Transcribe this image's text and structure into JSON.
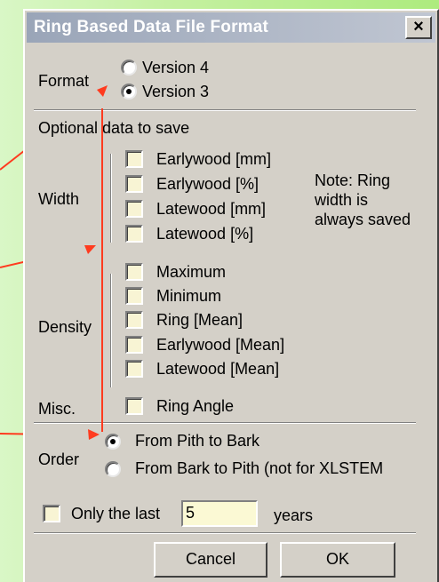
{
  "dialog": {
    "title": "Ring Based Data File Format",
    "close_glyph": "×",
    "format": {
      "label": "Format",
      "options": [
        {
          "label": "Version 4",
          "selected": false
        },
        {
          "label": "Version 3",
          "selected": true
        }
      ]
    },
    "optional": {
      "heading": "Optional data to save",
      "width": {
        "label": "Width",
        "items": [
          "Earlywood [mm]",
          "Earlywood [%]",
          "Latewood [mm]",
          "Latewood [%]"
        ],
        "note": [
          "Note: Ring",
          "width is",
          "always saved"
        ]
      },
      "density": {
        "label": "Density",
        "items": [
          "Maximum",
          "Minimum",
          "Ring [Mean]",
          "Earlywood [Mean]",
          "Latewood [Mean]"
        ]
      },
      "misc": {
        "label": "Misc.",
        "items": [
          "Ring Angle"
        ]
      }
    },
    "order": {
      "label": "Order",
      "options": [
        {
          "label": "From Pith to Bark",
          "selected": true
        },
        {
          "label": "From Bark to Pith (not for XLSTEM",
          "selected": false
        }
      ]
    },
    "only_last": {
      "checkbox_label": "Only the last",
      "value": "5",
      "suffix": "years",
      "checked": false
    },
    "buttons": {
      "cancel": "Cancel",
      "ok": "OK"
    }
  },
  "colors": {
    "dialog_bg": "#d4d0c8",
    "title_text": "#ffffff",
    "annotation_arrow": "#ff3b1f",
    "desktop_green": "#adeb7e"
  }
}
